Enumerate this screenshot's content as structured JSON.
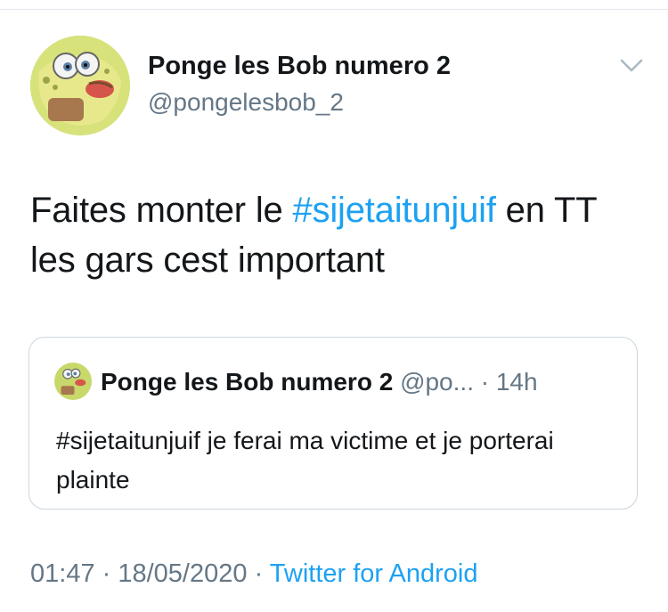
{
  "tweet": {
    "author": {
      "display_name": "Ponge les Bob numero 2",
      "handle": "@pongelesbob_2",
      "avatar_icon": "spongebob-avatar-icon"
    },
    "menu_icon": "chevron-down-icon",
    "text_before": "Faites monter le ",
    "hashtag": "#sijetaitunjuif",
    "text_after": " en TT les gars cest important",
    "quoted_tweet": {
      "display_name": "Ponge les Bob numero 2",
      "handle_truncated": "@po...",
      "separator": " · ",
      "time": "14h",
      "text": "#sijetaitunjuif je ferai ma victime et je porterai plainte"
    },
    "time": "01:47",
    "separator1": " · ",
    "date": "18/05/2020",
    "separator2": " · ",
    "source": "Twitter for Android"
  },
  "colors": {
    "link": "#1da1f2",
    "secondary_text": "#657786",
    "border": "#ccd6dd"
  }
}
